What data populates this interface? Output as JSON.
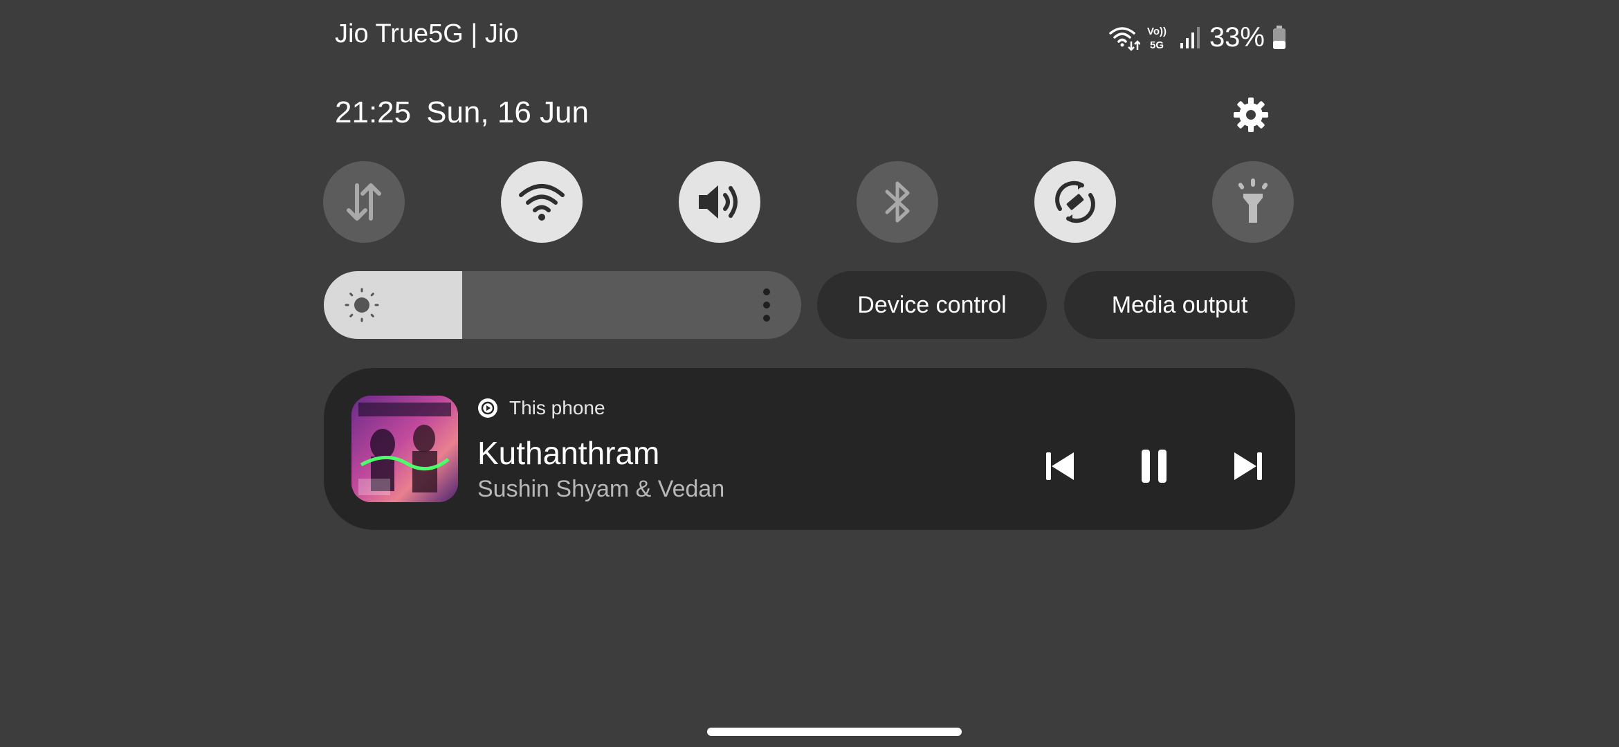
{
  "status_bar": {
    "carrier": "Jio True5G | Jio",
    "battery": "33%",
    "icons": [
      "wifi-data-icon",
      "volte-5g-icon",
      "signal-icon",
      "battery-icon"
    ],
    "volte_label_top": "Vo))",
    "volte_label_bottom": "5G"
  },
  "header": {
    "time": "21:25",
    "date": "Sun, 16 Jun",
    "settings_icon": "gear-icon"
  },
  "quick_toggles": [
    {
      "name": "mobile-data",
      "icon": "up-down-arrows-icon",
      "state": "off"
    },
    {
      "name": "wifi",
      "icon": "wifi-icon",
      "state": "on"
    },
    {
      "name": "sound",
      "icon": "volume-icon",
      "state": "on"
    },
    {
      "name": "bluetooth",
      "icon": "bluetooth-icon",
      "state": "off"
    },
    {
      "name": "auto-rotate",
      "icon": "rotate-icon",
      "state": "on"
    },
    {
      "name": "flashlight",
      "icon": "flashlight-icon",
      "state": "off"
    }
  ],
  "brightness": {
    "level": 0.29,
    "icon": "sun-icon"
  },
  "buttons": {
    "device_control": "Device control",
    "media_output": "Media output"
  },
  "media": {
    "source": "This phone",
    "title": "Kuthanthram",
    "artist": "Sushin Shyam & Vedan",
    "controls": [
      "previous-icon",
      "pause-icon",
      "next-icon"
    ]
  },
  "colors": {
    "background": "#3d3d3d",
    "toggle_on": "#e4e4e4",
    "toggle_off": "#5c5c5c",
    "card": "#252525"
  }
}
